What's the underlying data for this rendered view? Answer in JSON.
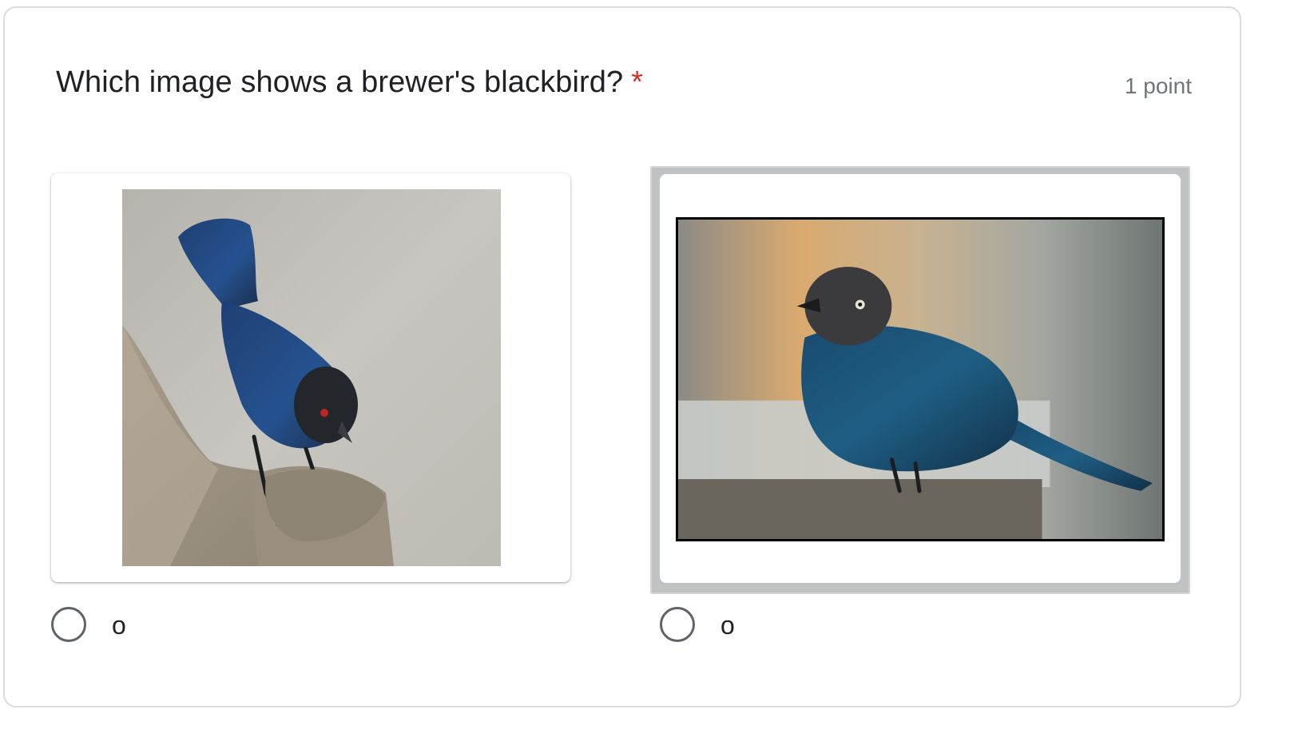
{
  "question": {
    "title": "Which image shows a brewer's blackbird?",
    "required_marker": "*",
    "points": "1 point"
  },
  "options": [
    {
      "label": "o",
      "image_icon": "bird-photo-icon",
      "selected": false
    },
    {
      "label": "o",
      "image_icon": "bird-photo-icon",
      "selected": false
    }
  ],
  "colors": {
    "required": "#d93025",
    "text": "#202124",
    "muted": "#70757a",
    "bird1_blue": "#1f4f86",
    "bird2_blue": "#1d5a78"
  }
}
